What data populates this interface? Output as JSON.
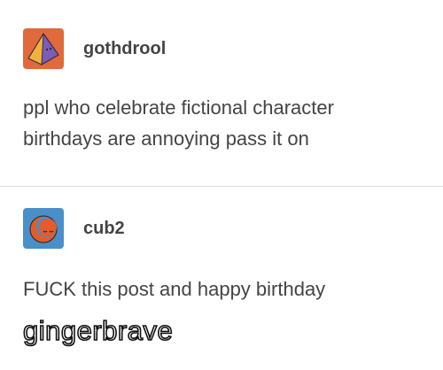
{
  "posts": [
    {
      "username": "gothdrool",
      "avatar_icon": "pyramid-icon",
      "avatar_colors": {
        "background": "#e06a3b",
        "left_face": "#f0b33a",
        "right_face": "#7b5db8"
      },
      "text_line1": "ppl who celebrate fictional character",
      "text_line2": "birthdays are annoying pass it on"
    },
    {
      "username": "cub2",
      "avatar_icon": "crescent-face-icon",
      "avatar_colors": {
        "background": "#4a8fc8",
        "face": "#e45b2c"
      },
      "text_line1": "FUCK this post and happy birthday"
    }
  ],
  "caption": "gingerbrave",
  "colors": {
    "text": "#444444",
    "divider": "#dddddd",
    "caption_fill": "#ffffff",
    "caption_stroke": "#111111"
  }
}
